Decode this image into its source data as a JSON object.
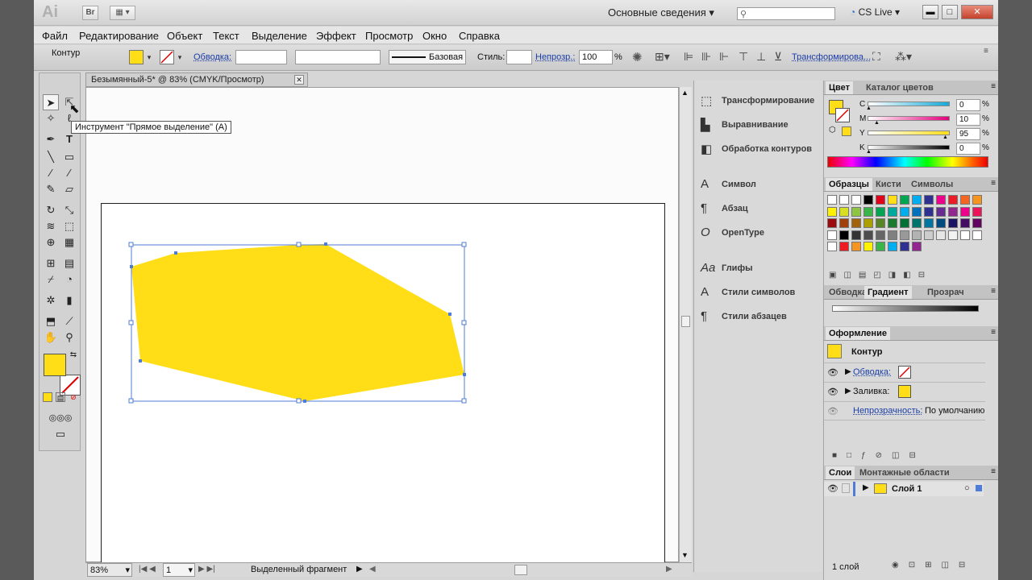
{
  "app": {
    "logo": "Ai",
    "bridge": "Br"
  },
  "workspace": {
    "label": "Основные сведения",
    "cs_live": "CS Live"
  },
  "window_controls": {
    "minimize": "▬",
    "maximize": "□",
    "close": "✕"
  },
  "menu": [
    "Файл",
    "Редактирование",
    "Объект",
    "Текст",
    "Выделение",
    "Эффект",
    "Просмотр",
    "Окно",
    "Справка"
  ],
  "control": {
    "selection": "Контур",
    "stroke_label": "Обводка:",
    "stroke_style": "Базовая",
    "style_label": "Стиль:",
    "opacity_label": "Непрозр.:",
    "opacity_value": "100",
    "percent": "%",
    "transform_link": "Трансформирова..."
  },
  "tools": {
    "tooltip": "Инструмент \"Прямое выделение\" (A)",
    "fill_color": "#ffde17"
  },
  "document": {
    "tab_title": "Безымянный-5* @ 83% (CMYK/Просмотр)",
    "shape_fill": "#ffde17"
  },
  "status": {
    "zoom": "83%",
    "page": "1",
    "mode": "Выделенный фрагмент"
  },
  "dock": [
    "Трансформирование",
    "Выравнивание",
    "Обработка контуров",
    "Символ",
    "Абзац",
    "OpenType",
    "Глифы",
    "Стили символов",
    "Стили абзацев"
  ],
  "color_panel": {
    "tabs": [
      "Цвет",
      "Каталог цветов"
    ],
    "channels": [
      {
        "name": "C",
        "value": "0",
        "color": "#15a9d8"
      },
      {
        "name": "M",
        "value": "10",
        "color": "#e4007c"
      },
      {
        "name": "Y",
        "value": "95",
        "color": "#ffde17"
      },
      {
        "name": "K",
        "value": "0",
        "color": "#000000"
      }
    ],
    "percent": "%"
  },
  "swatches_panel": {
    "tabs": [
      "Образцы",
      "Кисти",
      "Символы"
    ]
  },
  "gradient_panel": {
    "tabs": [
      "Обводка",
      "Градиент",
      "Прозрач"
    ]
  },
  "appearance_panel": {
    "title": "Оформление",
    "object": "Контур",
    "stroke": "Обводка:",
    "fill": "Заливка:",
    "opacity_link": "Непрозрачность:",
    "opacity_value": "По умолчанию"
  },
  "layers_panel": {
    "tabs": [
      "Слои",
      "Монтажные области"
    ],
    "layer_name": "Слой 1",
    "count": "1 слой"
  }
}
